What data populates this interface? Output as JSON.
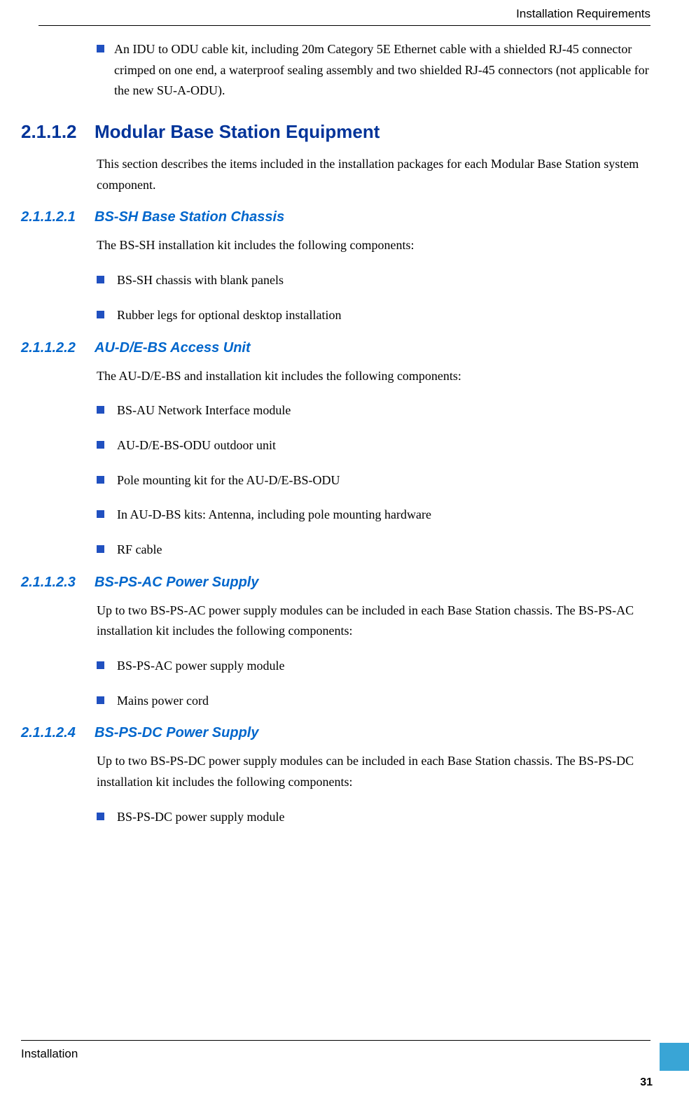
{
  "header": {
    "running_title": "Installation Requirements"
  },
  "sections": {
    "intro_bullet": "An IDU to ODU cable kit, including 20m Category 5E Ethernet cable with a shielded RJ-45 connector crimped on one end, a waterproof sealing assembly and two shielded RJ-45 connectors (not applicable for the new SU-A-ODU).",
    "h2": {
      "num": "2.1.1.2",
      "title": "Modular Base Station Equipment",
      "intro": "This section describes the items included in the installation packages for each Modular Base Station system component."
    },
    "s1": {
      "num": "2.1.1.2.1",
      "title": "BS-SH Base Station Chassis",
      "intro": "The BS-SH installation kit includes the following components:",
      "items": [
        "BS-SH chassis with blank panels",
        "Rubber legs for optional desktop installation"
      ]
    },
    "s2": {
      "num": "2.1.1.2.2",
      "title": "AU-D/E-BS Access Unit",
      "intro": "The AU-D/E-BS and installation kit includes the following components:",
      "items": [
        "BS-AU Network Interface module",
        "AU-D/E-BS-ODU outdoor unit",
        "Pole mounting kit for the AU-D/E-BS-ODU",
        "In AU-D-BS kits: Antenna, including pole mounting hardware",
        "RF cable"
      ]
    },
    "s3": {
      "num": "2.1.1.2.3",
      "title": "BS-PS-AC Power Supply",
      "intro": "Up to two BS-PS-AC power supply modules can be included in each Base Station chassis. The BS-PS-AC installation kit includes the following components:",
      "items": [
        "BS-PS-AC power supply module",
        "Mains power cord"
      ]
    },
    "s4": {
      "num": "2.1.1.2.4",
      "title": "BS-PS-DC Power Supply",
      "intro": "Up to two BS-PS-DC power supply modules can be included in each Base Station chassis. The BS-PS-DC installation kit includes the following components:",
      "items": [
        "BS-PS-DC power supply module"
      ]
    }
  },
  "footer": {
    "chapter": "Installation",
    "page": "31"
  }
}
